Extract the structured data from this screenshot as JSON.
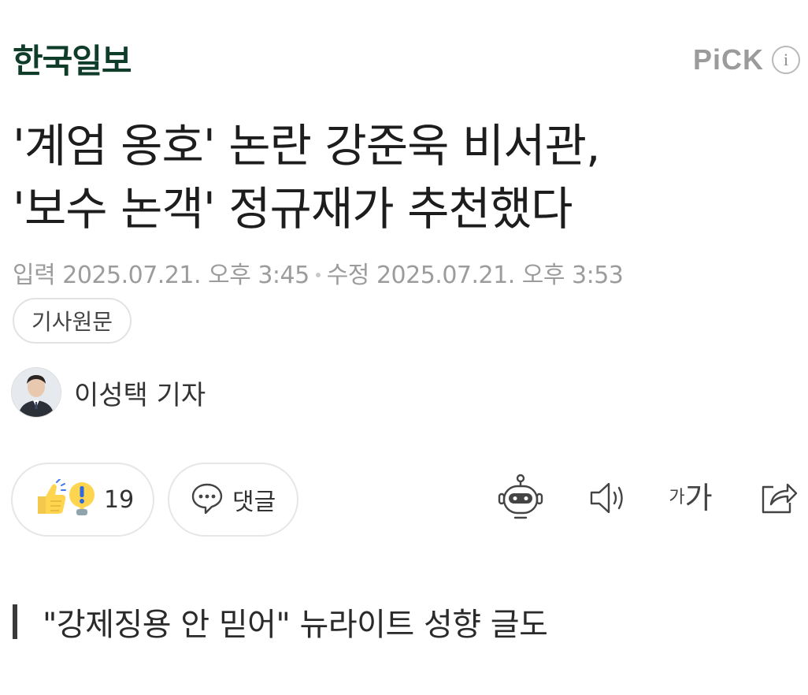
{
  "header": {
    "press_name": "한국일보",
    "pick_label": "PiCK",
    "info_glyph": "i"
  },
  "article": {
    "headline_line1": "'계엄 옹호' 논란 강준욱 비서관,",
    "headline_line2": "'보수 논객' 정규재가 추천했다",
    "input_label": "입력",
    "input_datetime": "2025.07.21. 오후 3:45",
    "modified_label": "수정",
    "modified_datetime": "2025.07.21. 오후 3:53",
    "original_button": "기사원문",
    "reporter": "이성택 기자",
    "subheading": "\"강제징용 안 믿어\" 뉴라이트 성향 글도"
  },
  "actions": {
    "reaction_count": "19",
    "comment_label": "댓글",
    "font_size_small": "가",
    "font_size_large": "가"
  },
  "icons": {
    "reaction": "thumbs-up-emoji-icon",
    "comment": "speech-bubble-icon",
    "summary_bot": "robot-icon",
    "tts": "speaker-icon",
    "font_size": "font-size-icon",
    "share": "share-icon"
  },
  "colors": {
    "press_logo": "#0f3d2a",
    "meta_text": "#9c9c9c",
    "pill_border": "#e6e6e6"
  }
}
